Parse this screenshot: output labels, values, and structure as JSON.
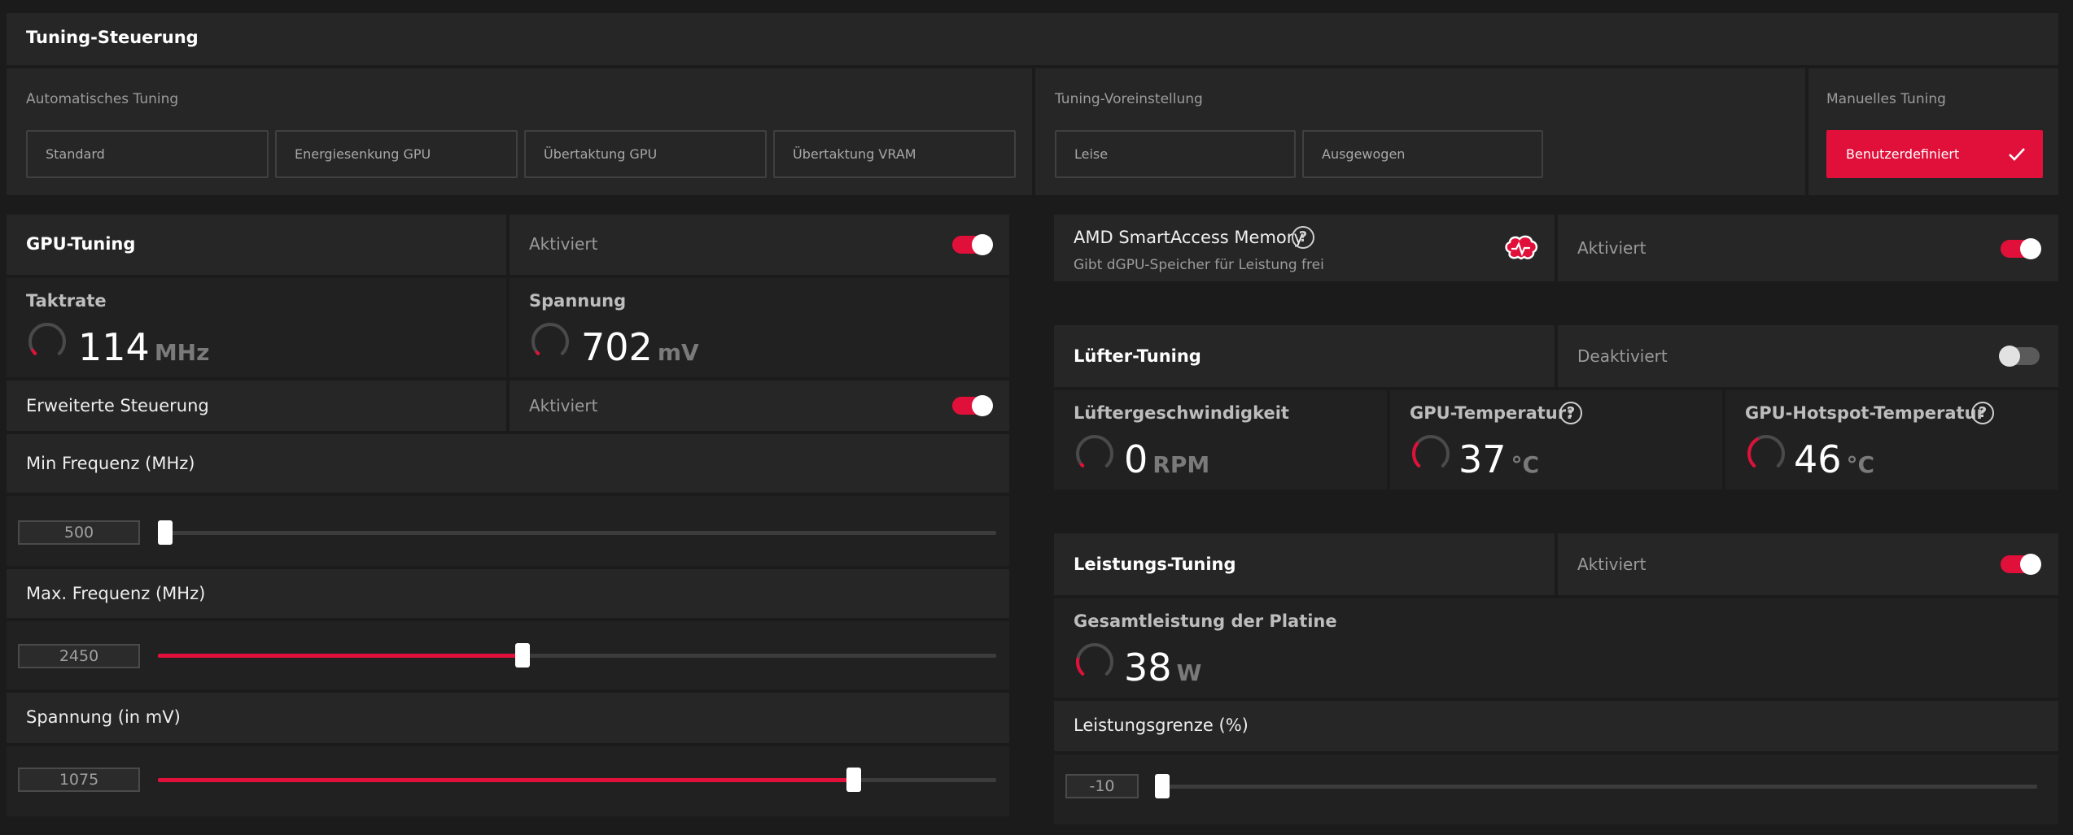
{
  "header": {
    "title": "Tuning-Steuerung"
  },
  "auto_tuning": {
    "label": "Automatisches Tuning",
    "options": [
      "Standard",
      "Energiesenkung GPU",
      "Übertaktung GPU",
      "Übertaktung VRAM"
    ]
  },
  "preset": {
    "label": "Tuning-Voreinstellung",
    "options": [
      "Leise",
      "Ausgewogen"
    ]
  },
  "manual": {
    "label": "Manuelles Tuning",
    "option": "Benutzerdefiniert",
    "selected": true
  },
  "gpu_tuning": {
    "title": "GPU-Tuning",
    "status": "Aktiviert",
    "enabled": true,
    "clock": {
      "label": "Taktrate",
      "value": "114",
      "unit": "MHz",
      "fraction": 0.05
    },
    "voltage": {
      "label": "Spannung",
      "value": "702",
      "unit": "mV",
      "fraction": 0.0
    },
    "advanced": {
      "label": "Erweiterte Steuerung",
      "status": "Aktiviert",
      "enabled": true
    },
    "min_freq": {
      "label": "Min Frequenz (MHz)",
      "value": "500",
      "fraction": 0.0
    },
    "max_freq": {
      "label": "Max. Frequenz (MHz)",
      "value": "2450",
      "fraction": 0.435
    },
    "voltage_slider": {
      "label": "Spannung (in mV)",
      "value": "1075",
      "fraction": 0.83
    }
  },
  "sam": {
    "title": "AMD SmartAccess Memory",
    "subtitle": "Gibt dGPU-Speicher für Leistung frei",
    "help_icon": "question-icon",
    "brain_icon": "brain-icon",
    "status": "Aktiviert",
    "enabled": true
  },
  "fan_tuning": {
    "title": "Lüfter-Tuning",
    "status": "Deaktiviert",
    "enabled": false,
    "fan_speed": {
      "label": "Lüftergeschwindigkeit",
      "value": "0",
      "unit": "RPM",
      "fraction": 0.0
    },
    "gpu_temp": {
      "label": "GPU-Temperatur:",
      "value": "37",
      "unit": "°C",
      "fraction": 0.3
    },
    "hotspot_temp": {
      "label": "GPU-Hotspot-Temperatur",
      "value": "46",
      "unit": "°C",
      "fraction": 0.38
    }
  },
  "power_tuning": {
    "title": "Leistungs-Tuning",
    "status": "Aktiviert",
    "enabled": true,
    "board_power": {
      "label": "Gesamtleistung der Platine",
      "value": "38",
      "unit": "W",
      "fraction": 0.2
    },
    "power_limit": {
      "label": "Leistungsgrenze (%)",
      "value": "-10",
      "fraction": 0.0
    }
  },
  "colors": {
    "accent": "#e0103a",
    "panel": "#262626",
    "background": "#1b1b1b"
  }
}
